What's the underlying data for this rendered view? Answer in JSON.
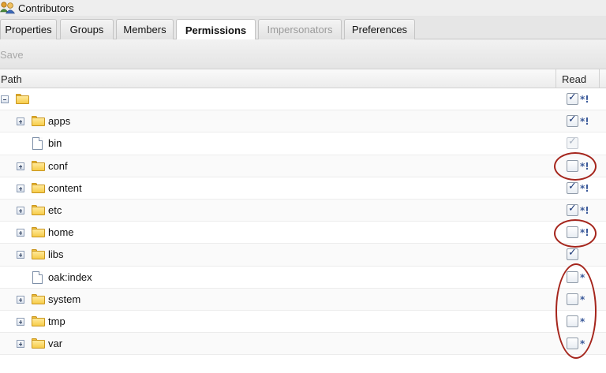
{
  "window": {
    "title": "Contributors",
    "icon": "users-group-icon"
  },
  "tabs": [
    {
      "label": "Properties",
      "state": "normal"
    },
    {
      "label": "Groups",
      "state": "normal"
    },
    {
      "label": "Members",
      "state": "normal"
    },
    {
      "label": "Permissions",
      "state": "active"
    },
    {
      "label": "Impersonators",
      "state": "disabled"
    },
    {
      "label": "Preferences",
      "state": "normal"
    }
  ],
  "toolbar": {
    "save_label": "Save",
    "save_enabled": false
  },
  "columns": {
    "path": "Path",
    "read": "Read"
  },
  "rows": [
    {
      "name": "",
      "type": "folder",
      "expander": "minus",
      "read": true,
      "read_enabled": true,
      "mark": "*!"
    },
    {
      "name": "apps",
      "type": "folder",
      "expander": "plus",
      "read": true,
      "read_enabled": true,
      "mark": "*!"
    },
    {
      "name": "bin",
      "type": "file",
      "expander": "none",
      "read": true,
      "read_enabled": false,
      "mark": ""
    },
    {
      "name": "conf",
      "type": "folder",
      "expander": "plus",
      "read": false,
      "read_enabled": true,
      "mark": "*!"
    },
    {
      "name": "content",
      "type": "folder",
      "expander": "plus",
      "read": true,
      "read_enabled": true,
      "mark": "*!"
    },
    {
      "name": "etc",
      "type": "folder",
      "expander": "plus",
      "read": true,
      "read_enabled": true,
      "mark": "*!"
    },
    {
      "name": "home",
      "type": "folder",
      "expander": "plus",
      "read": false,
      "read_enabled": true,
      "mark": "*!"
    },
    {
      "name": "libs",
      "type": "folder",
      "expander": "plus",
      "read": true,
      "read_enabled": true,
      "mark": ""
    },
    {
      "name": "oak:index",
      "type": "file",
      "expander": "none",
      "read": false,
      "read_enabled": true,
      "mark": "*"
    },
    {
      "name": "system",
      "type": "folder",
      "expander": "plus",
      "read": false,
      "read_enabled": true,
      "mark": "*"
    },
    {
      "name": "tmp",
      "type": "folder",
      "expander": "plus",
      "read": false,
      "read_enabled": true,
      "mark": "*"
    },
    {
      "name": "var",
      "type": "folder",
      "expander": "plus",
      "read": false,
      "read_enabled": true,
      "mark": "*"
    }
  ],
  "annotation_color": "#a5251c"
}
